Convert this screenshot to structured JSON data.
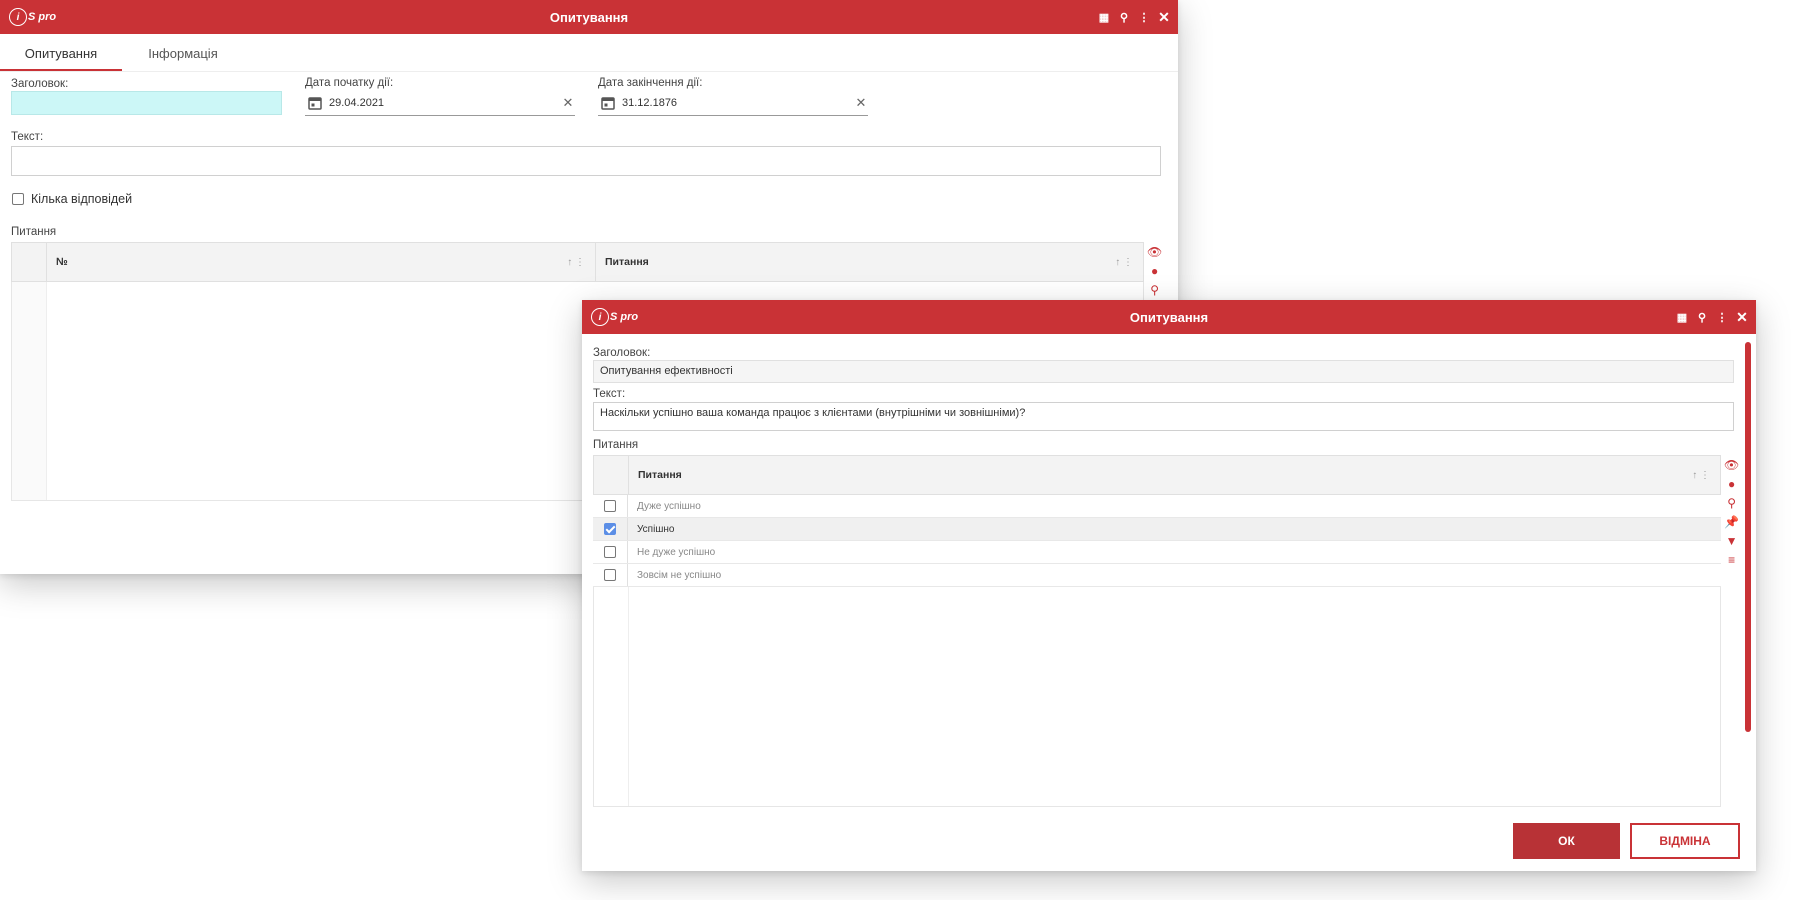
{
  "colors": {
    "accent": "#c93236",
    "check": "#5b8ee6"
  },
  "window1": {
    "title": "Опитування",
    "logo": "S pro",
    "tabs": [
      {
        "label": "Опитування"
      },
      {
        "label": "Інформація"
      }
    ],
    "header_label": "Заголовок:",
    "start_label": "Дата початку дії:",
    "start_value": "29.04.2021",
    "end_label": "Дата закінчення дії:",
    "end_value": "31.12.1876",
    "text_label": "Текст:",
    "multiple_label": "Кілька відповідей",
    "questions_label": "Питання",
    "grid": {
      "columns": [
        {
          "label": "№"
        },
        {
          "label": "Питання"
        }
      ]
    }
  },
  "window2": {
    "title": "Опитування",
    "logo": "S pro",
    "header_label": "Заголовок:",
    "header_value": "Опитування ефективності",
    "text_label": "Текст:",
    "text_value": "Наскільки успішно ваша команда працює з клієнтами (внутрішніми чи зовнішніми)?",
    "questions_label": "Питання",
    "grid": {
      "column": "Питання",
      "rows": [
        {
          "label": "Дуже успішно",
          "checked": false
        },
        {
          "label": "Успішно",
          "checked": true
        },
        {
          "label": "Не дуже успішно",
          "checked": false
        },
        {
          "label": "Зовсім не успішно",
          "checked": false
        }
      ]
    },
    "ok_label": "ОК",
    "cancel_label": "ВІДМІНА"
  }
}
